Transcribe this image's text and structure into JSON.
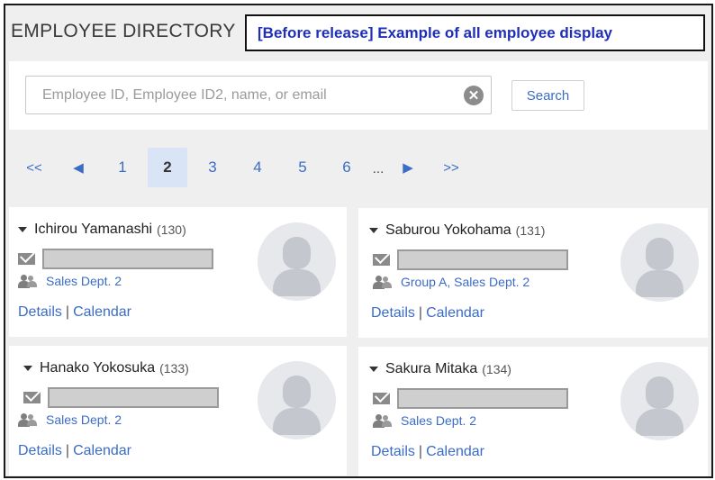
{
  "header": {
    "title": "EMPLOYEE DIRECTORY",
    "banner": "[Before release] Example of all employee display"
  },
  "search": {
    "placeholder": "Employee ID, Employee ID2, name, or email",
    "clear_icon": "clear-icon",
    "button_label": "Search"
  },
  "pagination": {
    "first": "<<",
    "prev": "◀",
    "pages": [
      "1",
      "2",
      "3",
      "4",
      "5",
      "6"
    ],
    "current": "2",
    "ellipsis": "...",
    "next": "▶",
    "last": ">>"
  },
  "employees": [
    {
      "name": "Ichirou Yamanashi",
      "id": "(130)",
      "dept": "Sales Dept. 2",
      "details": "Details",
      "calendar": "Calendar",
      "separator": "|"
    },
    {
      "name": "Saburou Yokohama",
      "id": "(131)",
      "dept": "Group A, Sales Dept. 2",
      "details": "Details",
      "calendar": "Calendar",
      "separator": "|"
    },
    {
      "name": "Hanako Yokosuka",
      "id": "(133)",
      "dept": "Sales Dept. 2",
      "details": "Details",
      "calendar": "Calendar",
      "separator": "|"
    },
    {
      "name": "Sakura Mitaka",
      "id": "(134)",
      "dept": "Sales Dept. 2",
      "details": "Details",
      "calendar": "Calendar",
      "separator": "|"
    }
  ],
  "colors": {
    "link": "#3b6cc6",
    "banner_text": "#1f2fb8",
    "current_page_bg": "#d9e4f6"
  }
}
